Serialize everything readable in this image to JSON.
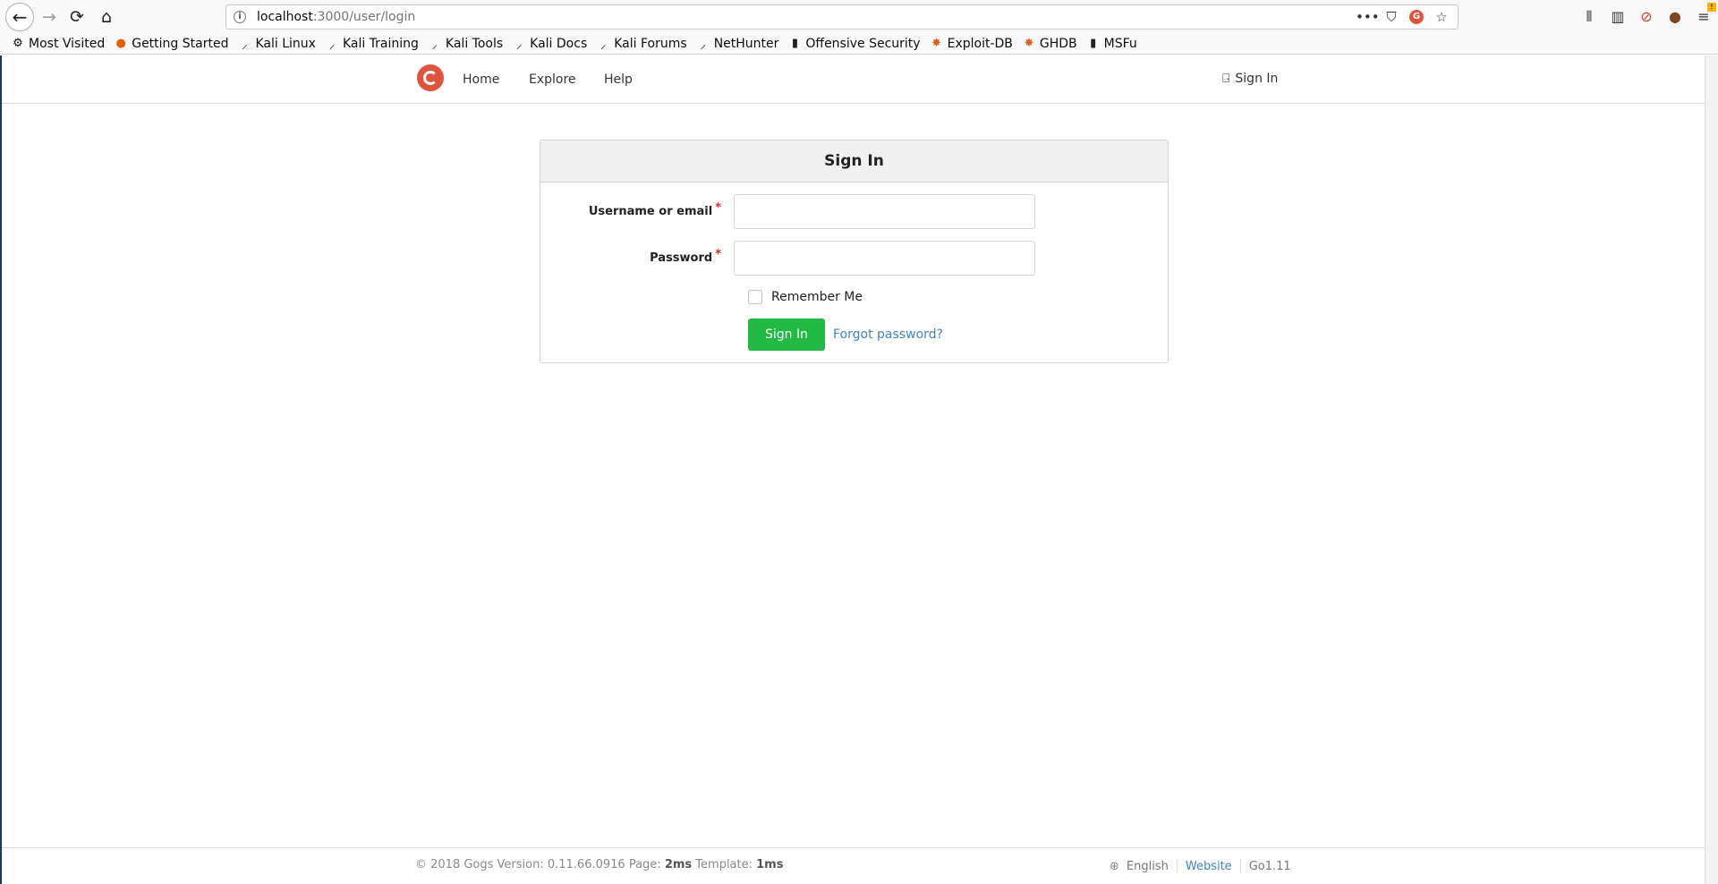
{
  "browser": {
    "url_host": "localhost",
    "url_path": ":3000/user/login",
    "bookmarks": [
      {
        "label": "Most Visited",
        "icon": "gear-icon"
      },
      {
        "label": "Getting Started",
        "icon": "firefox-icon"
      },
      {
        "label": "Kali Linux",
        "icon": "kali-dragon-icon"
      },
      {
        "label": "Kali Training",
        "icon": "kali-dragon-icon"
      },
      {
        "label": "Kali Tools",
        "icon": "kali-dragon-icon"
      },
      {
        "label": "Kali Docs",
        "icon": "kali-dragon-icon"
      },
      {
        "label": "Kali Forums",
        "icon": "kali-dragon-icon"
      },
      {
        "label": "NetHunter",
        "icon": "kali-dragon-icon"
      },
      {
        "label": "Offensive Security",
        "icon": "offsec-icon"
      },
      {
        "label": "Exploit-DB",
        "icon": "exploit-db-icon"
      },
      {
        "label": "GHDB",
        "icon": "exploit-db-icon"
      },
      {
        "label": "MSFu",
        "icon": "offsec-icon"
      }
    ]
  },
  "nav": {
    "home": "Home",
    "explore": "Explore",
    "help": "Help",
    "sign_in": "Sign In"
  },
  "login": {
    "title": "Sign In",
    "username_label": "Username or email",
    "password_label": "Password",
    "required_mark": "*",
    "username_value": "",
    "password_value": "",
    "remember_label": "Remember Me",
    "remember_checked": false,
    "submit_label": "Sign In",
    "forgot_label": "Forgot password?"
  },
  "footer": {
    "copyright": "© 2018 Gogs Version: 0.11.66.0916 Page:",
    "page_time": "2ms",
    "template_label": "Template:",
    "template_time": "1ms",
    "language": "English",
    "website": "Website",
    "go_version": "Go1.11"
  },
  "colors": {
    "primary_button": "#21ba45",
    "link": "#4183c4",
    "required": "#db2828",
    "logo": "#e0533c"
  }
}
